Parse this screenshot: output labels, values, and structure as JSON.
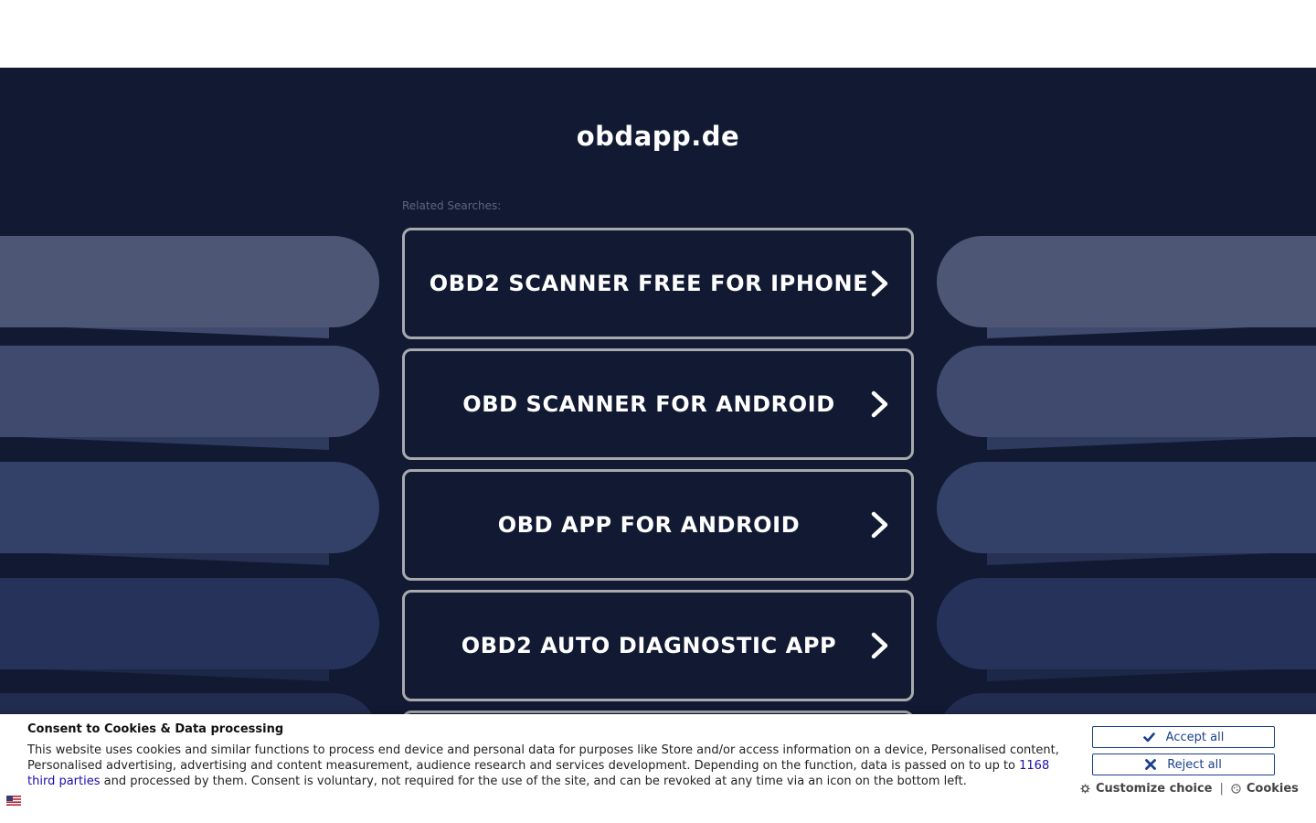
{
  "site": {
    "title": "obdapp.de",
    "related_label": "Related Searches:"
  },
  "searches": [
    {
      "label": "OBD2 SCANNER FREE FOR IPHONE",
      "icon": "chevron-right-icon"
    },
    {
      "label": "OBD SCANNER FOR ANDROID",
      "icon": "chevron-right-icon"
    },
    {
      "label": "OBD APP FOR ANDROID",
      "icon": "chevron-right-icon"
    },
    {
      "label": "OBD2 AUTO DIAGNOSTIC APP",
      "icon": "chevron-right-icon"
    }
  ],
  "cookie": {
    "title": "Consent to Cookies & Data processing",
    "text_before": "This website uses cookies and similar functions to process end device and personal data for purposes like Store and/or access information on a device, Personalised content, Personalised advertising, advertising and content measurement, audience research and services development. Depending on the function, data is passed on to up to ",
    "third_parties_link": "1168 third parties",
    "text_after": " and processed by them. Consent is voluntary, not required for the use of the site, and can be revoked at any time via an icon on the bottom left.",
    "accept_label": "Accept all",
    "reject_label": "Reject all",
    "customize_label": "Customize choice",
    "separator": "|",
    "cookies_label": "Cookies"
  },
  "colors": {
    "background": "#121a33",
    "card_border": "#a7a9ad",
    "button_accent": "#1a3f8c"
  }
}
